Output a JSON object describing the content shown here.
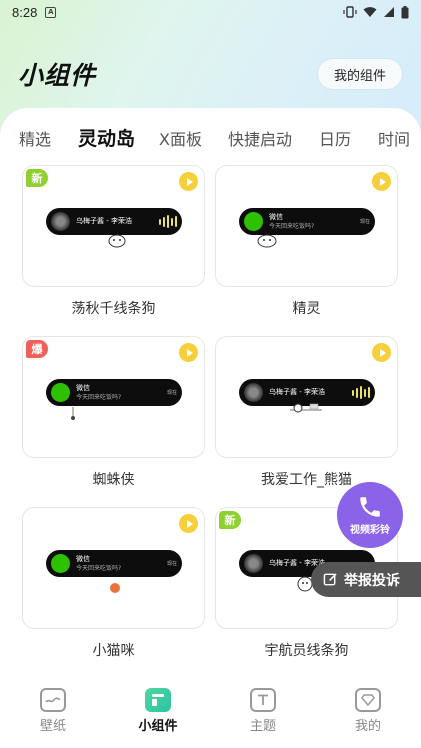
{
  "status_bar": {
    "time": "8:28",
    "notification_letter": "A"
  },
  "header": {
    "title": "小组件",
    "my_widgets_label": "我的组件"
  },
  "tabs": [
    {
      "label": "精选",
      "active": false
    },
    {
      "label": "灵动岛",
      "active": true
    },
    {
      "label": "X面板",
      "active": false
    },
    {
      "label": "快捷启动",
      "active": false
    },
    {
      "label": "日历",
      "active": false
    },
    {
      "label": "时间",
      "active": false
    }
  ],
  "cards": [
    {
      "name": "荡秋千线条狗",
      "badge": "新",
      "badge_color": "#8fd12f",
      "pill_title": "乌梅子酱 - 李荣浩",
      "pill_sub": "",
      "pill_right": "",
      "type": "music"
    },
    {
      "name": "精灵",
      "badge": "",
      "badge_color": "",
      "pill_title": "微信",
      "pill_sub": "今天回来吃饭吗?",
      "pill_right": "现在",
      "type": "wechat"
    },
    {
      "name": "蜘蛛侠",
      "badge": "爆",
      "badge_color": "#f0605a",
      "pill_title": "微信",
      "pill_sub": "今天回来吃饭吗?",
      "pill_right": "现在",
      "type": "wechat"
    },
    {
      "name": "我爱工作_熊猫",
      "badge": "",
      "badge_color": "",
      "pill_title": "乌梅子酱 - 李荣浩",
      "pill_sub": "",
      "pill_right": "",
      "type": "music"
    },
    {
      "name": "小猫咪",
      "badge": "",
      "badge_color": "",
      "pill_title": "微信",
      "pill_sub": "今天回来吃饭吗?",
      "pill_right": "现在",
      "type": "wechat"
    },
    {
      "name": "宇航员线条狗",
      "badge": "新",
      "badge_color": "#8fd12f",
      "pill_title": "乌梅子酱 - 李荣浩",
      "pill_sub": "",
      "pill_right": "",
      "type": "music"
    }
  ],
  "floating": {
    "call_label": "视频彩铃",
    "report_label": "举报投诉"
  },
  "bottom_nav": [
    {
      "label": "壁纸",
      "icon": "wallpaper-icon",
      "active": false
    },
    {
      "label": "小组件",
      "icon": "widget-icon",
      "active": true
    },
    {
      "label": "主题",
      "icon": "theme-icon",
      "active": false
    },
    {
      "label": "我的",
      "icon": "profile-icon",
      "active": false
    }
  ],
  "colors": {
    "accent_green": "#5ed1a5",
    "badge_new": "#8fd12f",
    "badge_hot": "#f0605a",
    "play_yellow": "#f7cf3a",
    "fab_purple": "#8a63e8",
    "wechat_green": "#2dc100"
  }
}
